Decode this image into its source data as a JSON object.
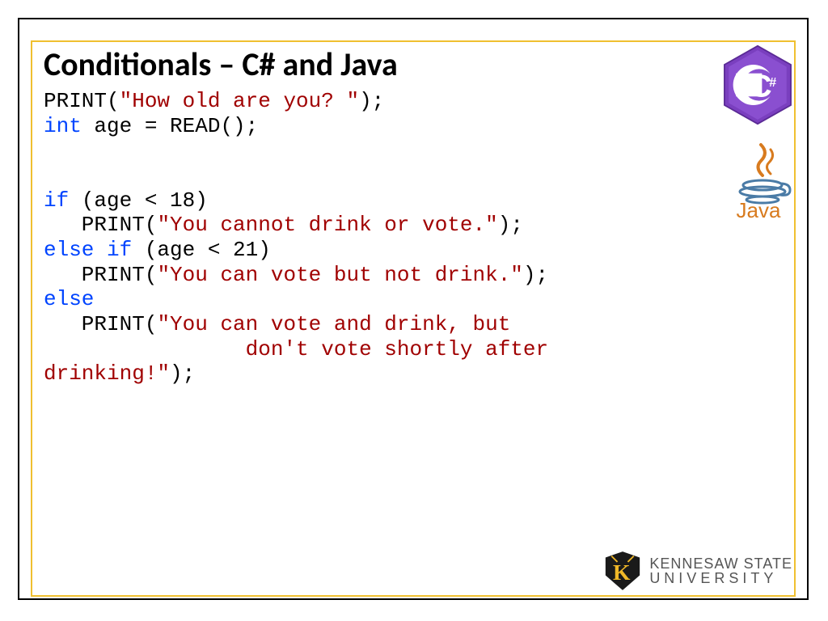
{
  "title": "Conditionals – C# and Java",
  "code": {
    "l1a": "PRINT(",
    "l1b": "\"How old are you? \"",
    "l1c": ");",
    "l2a": "int",
    "l2b": " age = READ();",
    "blank": "",
    "l3a": "if",
    "l3b": " (age < 18)",
    "l4a": "   PRINT(",
    "l4b": "\"You cannot drink or vote.\"",
    "l4c": ");",
    "l5a": "else if",
    "l5b": " (age < 21)",
    "l6a": "   PRINT(",
    "l6b": "\"You can vote but not drink.\"",
    "l6c": ");",
    "l7a": "else",
    "l8a": "   PRINT(",
    "l8b": "\"You can vote and drink, but",
    "l9": "                don't vote shortly after ",
    "l10a": "drinking!\"",
    "l10b": ");"
  },
  "logos": {
    "csharp": "C#",
    "java": "Java",
    "ksu1": "KENNESAW STATE",
    "ksu2": "UNIVERSITY"
  }
}
